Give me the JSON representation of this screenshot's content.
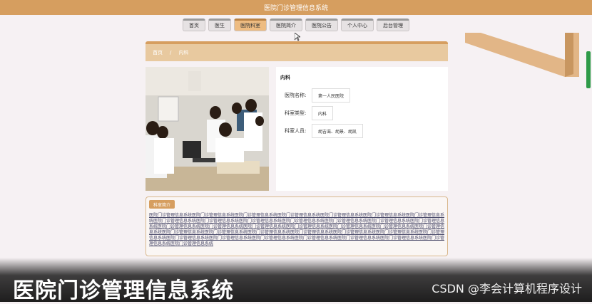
{
  "header": {
    "title": "医院门诊管理信息系统"
  },
  "nav": {
    "items": [
      {
        "label": "首页"
      },
      {
        "label": "医生"
      },
      {
        "label": "医院科室"
      },
      {
        "label": "医院简介"
      },
      {
        "label": "医院公告"
      },
      {
        "label": "个人中心"
      },
      {
        "label": "后台管理"
      }
    ],
    "active_index": 2
  },
  "breadcrumb": {
    "home": "首页",
    "separator": "/",
    "current": "内科"
  },
  "detail": {
    "title": "内科",
    "fields": [
      {
        "label": "医院名称:",
        "value": "第一人民医院"
      },
      {
        "label": "科室类型:",
        "value": "内科"
      },
      {
        "label": "科室人员:",
        "value": "胡吉滋、胡景、胡凯"
      }
    ]
  },
  "description": {
    "heading": "科室简介",
    "text": "医院门诊管理信息系统医院门诊管理信息系统医院门诊管理信息系统医院门诊管理信息系统医院门诊管理信息系统医院门诊管理信息系统医院门诊管理信息系统医院门诊管理信息系统医院门诊管理信息系统医院门诊管理信息系统医院门诊管理信息系统医院门诊管理信息系统医院门诊管理信息系统医院门诊管理信息系统医院门诊管理信息系统医院门诊管理信息系统医院门诊管理信息系统医院门诊管理信息系统医院门诊管理信息系统医院门诊管理信息系统医院门诊管理信息系统医院门诊管理信息系统医院门诊管理信息系统医院门诊管理信息系统医院门诊管理信息系统医院门诊管理信息系统医院门诊管理信息系统医院门诊管理信息系统医院门诊管理信息系统医院门诊管理信息系统医院门诊管理信息系统医院门诊管理信息系统医院门诊管理信息系统医院门诊管理信息系统医院门诊管理信息系统医院门诊管理信息系统"
  },
  "watermark": {
    "title": "医院门诊管理信息系统",
    "csdn": "CSDN @李会计算机程序设计"
  },
  "colors": {
    "brand": "#d69e5f",
    "active_tab": "#eebc82",
    "scrollbar": "#2e9a48"
  }
}
